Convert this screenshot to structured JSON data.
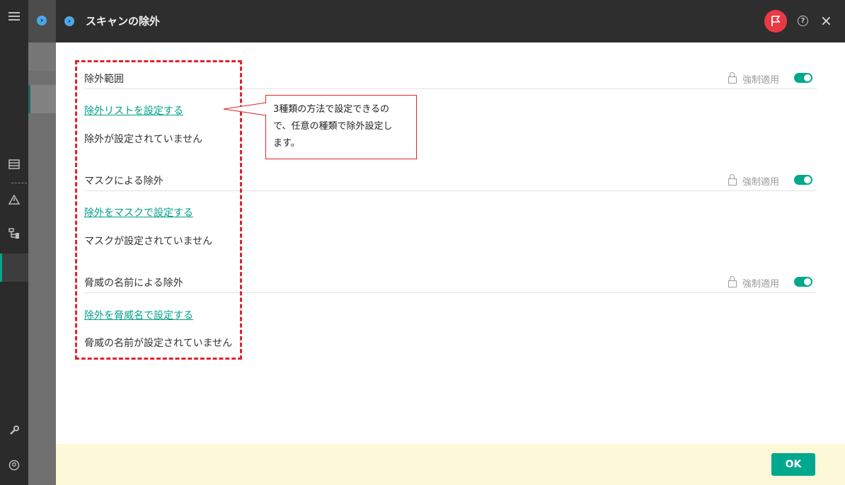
{
  "dialog": {
    "title": "スキャンの除外",
    "help_icon": "?",
    "close_icon": "×"
  },
  "sections": [
    {
      "title": "除外範囲",
      "enforce_label": "強制適用",
      "enforce_on": true,
      "link": "除外リストを設定する",
      "status": "除外が設定されていません"
    },
    {
      "title": "マスクによる除外",
      "enforce_label": "強制適用",
      "enforce_on": true,
      "link": "除外をマスクで設定する",
      "status": "マスクが設定されていません"
    },
    {
      "title": "脅威の名前による除外",
      "enforce_label": "強制適用",
      "enforce_on": true,
      "link": "除外を脅威名で設定する",
      "status": "脅威の名前が設定されていません"
    }
  ],
  "annotation": {
    "callout_lines": [
      "3種類の方法で設定できるの",
      "で、任意の種類で除外設定し",
      "ます。"
    ]
  },
  "footer": {
    "ok_label": "OK"
  },
  "colors": {
    "accent": "#00a88e",
    "link": "#00a088",
    "header_bg": "#2e2e2e",
    "footer_bg": "#fdf8d8",
    "annotation_red": "#e0242b",
    "flag_button": "#e83a45"
  },
  "icons": {
    "sidebar": [
      "menu-icon",
      "list-icon",
      "warning-icon",
      "tree-icon",
      "wrench-icon",
      "user-icon"
    ],
    "header": [
      "chevron-circle-icon",
      "flag-icon",
      "help-icon",
      "close-icon"
    ],
    "section": [
      "lock-icon",
      "toggle-switch"
    ]
  }
}
